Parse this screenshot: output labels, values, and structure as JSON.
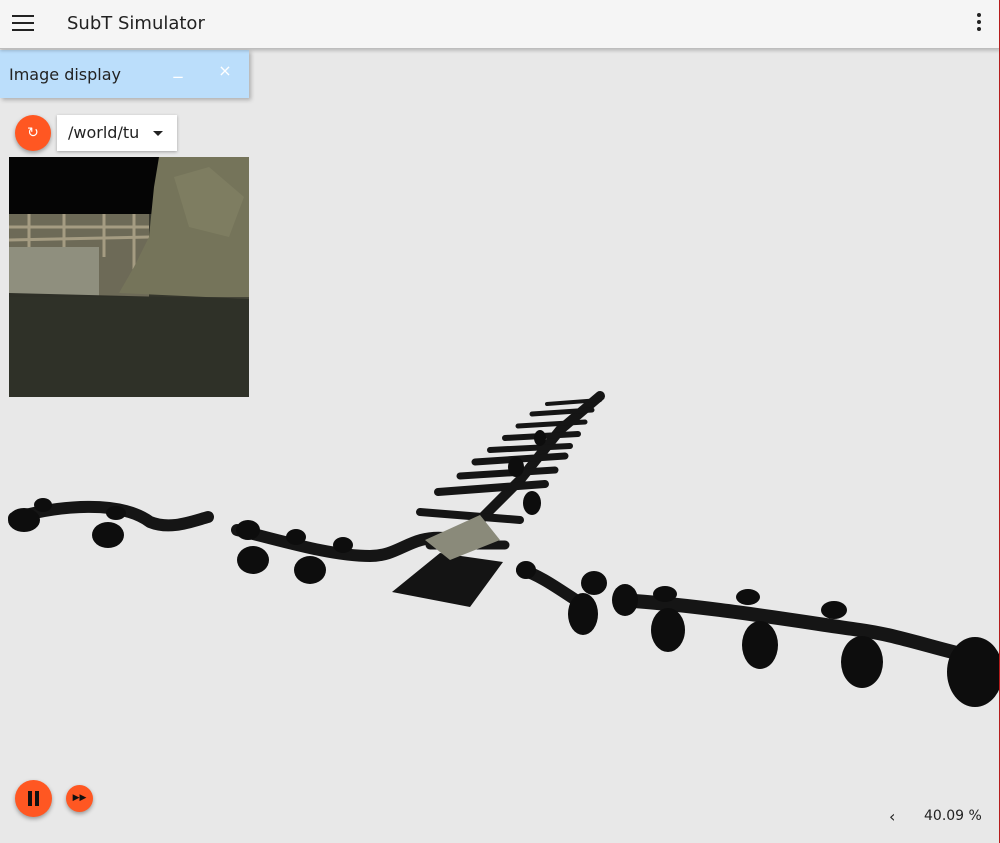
{
  "app": {
    "title": "SubT Simulator",
    "menu_icon": "hamburger-menu-icon",
    "more_icon": "more-vert-icon"
  },
  "image_display": {
    "title": "Image display",
    "minimize_label": "_",
    "close_label": "×",
    "topic": "/world/tunnel",
    "refresh_icon": "refresh-icon"
  },
  "controls": {
    "pause_icon": "pause-icon",
    "fast_forward_icon": "fast-forward-icon",
    "collapse_icon": "chevron-left-icon",
    "collapse_label": "‹",
    "real_time_factor": "40.09 %"
  },
  "colors": {
    "accent": "#ff5722",
    "panel_header": "#bbdefb",
    "topbar": "#f5f5f5",
    "scene_bg": "#e8e8e8"
  }
}
